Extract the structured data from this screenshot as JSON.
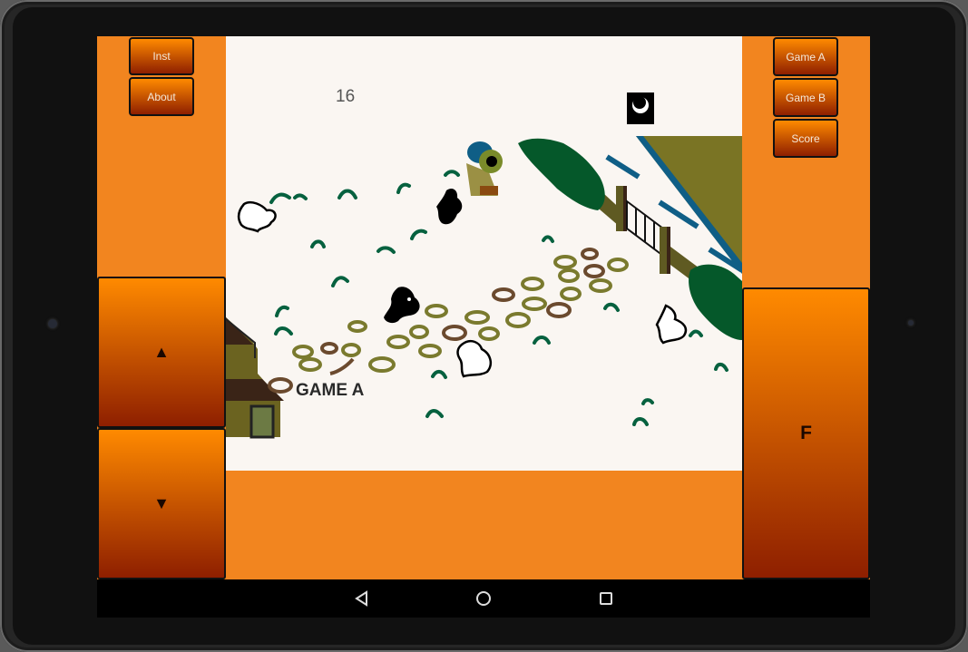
{
  "app": {
    "left_buttons": [
      {
        "label": "Inst"
      },
      {
        "label": "About"
      }
    ],
    "right_buttons": [
      {
        "label": "Game A"
      },
      {
        "label": "Game B"
      },
      {
        "label": "Score"
      }
    ],
    "controls": {
      "up_label": "▲",
      "down_label": "▼",
      "fire_label": "F"
    },
    "game": {
      "score": "16",
      "mode_label": "GAME A",
      "misses_icon": "miss-indicator-icon"
    },
    "colors": {
      "panel_orange": "#f2851f",
      "button_top": "#ff8a00",
      "button_bottom": "#8e1f00",
      "field_bg": "#faf6f2",
      "grass_green": "#06613f",
      "ring_olive": "#7a7a2e",
      "ring_brown": "#6b4a2e",
      "water_blue": "#0f5e86"
    }
  },
  "navbar": {
    "back_icon": "back-triangle-icon",
    "home_icon": "home-circle-icon",
    "recents_icon": "recents-square-icon"
  }
}
